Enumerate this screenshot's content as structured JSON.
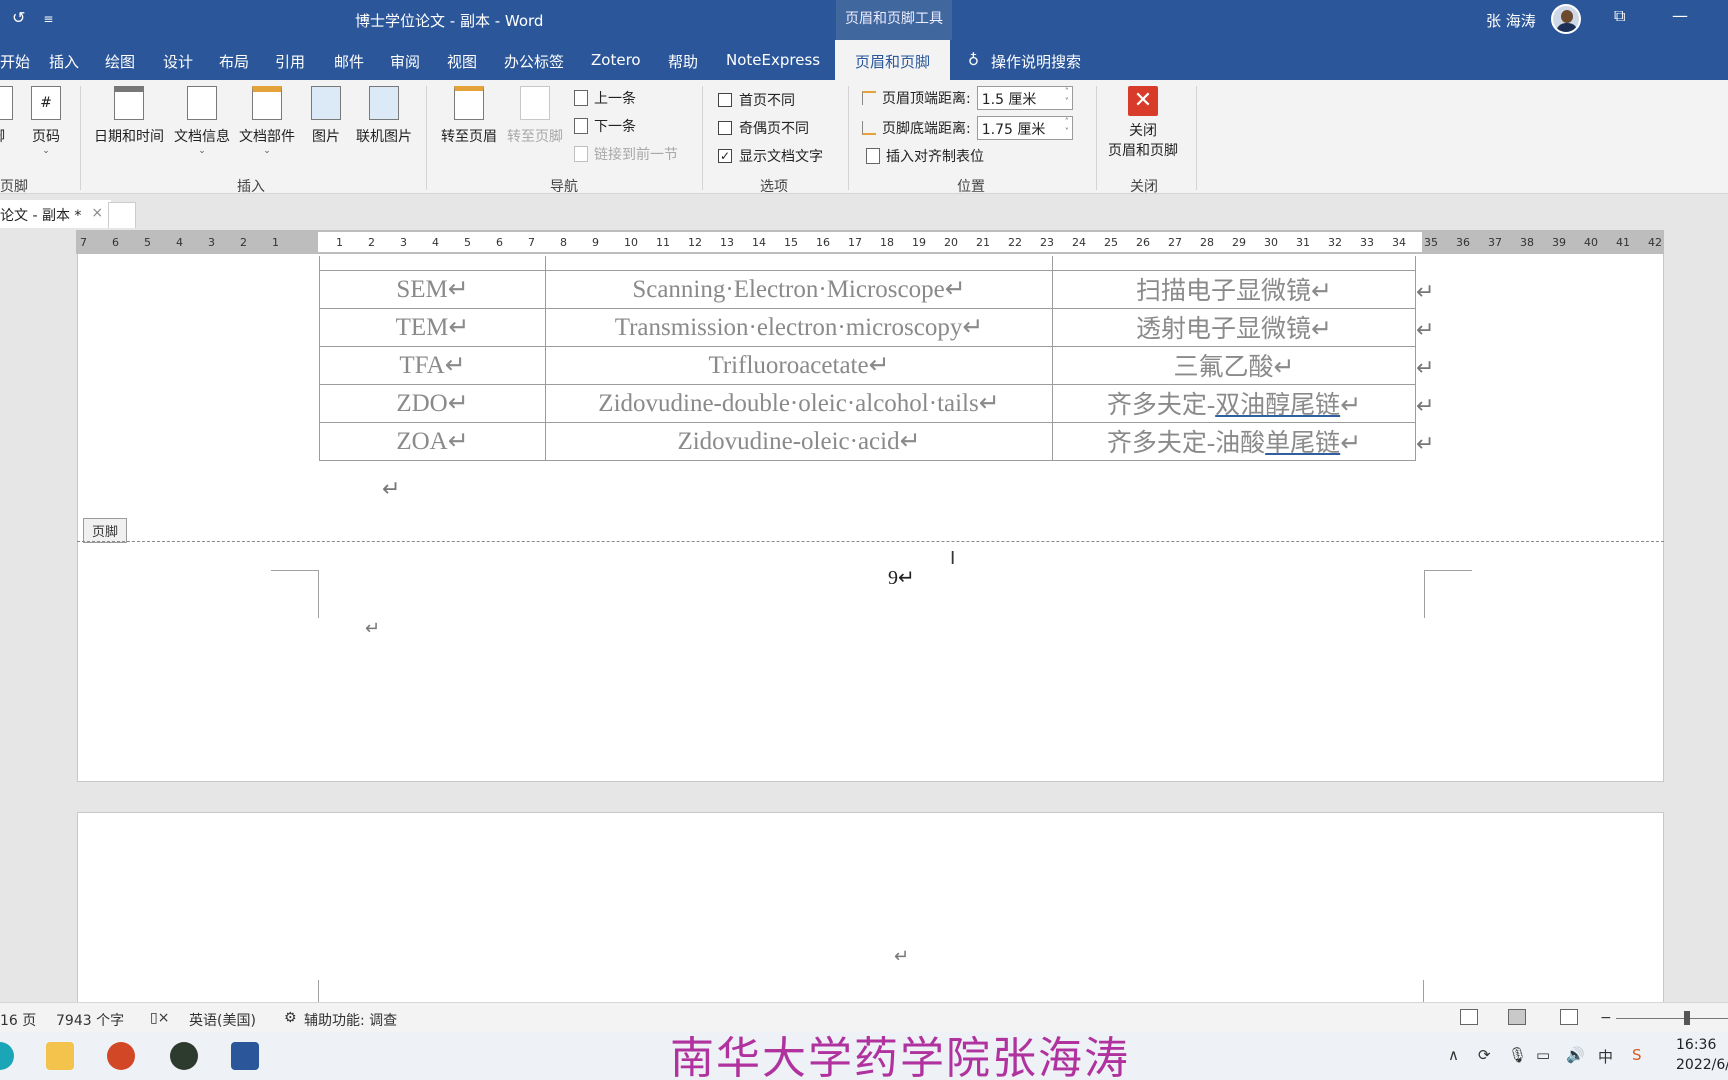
{
  "titlebar": {
    "doc_title": "博士学位论文 - 副本  -  Word",
    "context_tools": "页眉和页脚工具",
    "user_name": "张 海涛",
    "refresh_icon": "↺",
    "qat_icon": "≡",
    "restore_icon": "⧉",
    "minimize_icon": "—"
  },
  "tabs": [
    "开始",
    "插入",
    "绘图",
    "设计",
    "布局",
    "引用",
    "邮件",
    "审阅",
    "视图",
    "办公标签",
    "Zotero",
    "帮助",
    "NoteExpress",
    "页眉和页脚"
  ],
  "tell_me": "操作说明搜索",
  "ribbon": {
    "partial_btn": "脚",
    "page_number_btn": "页码",
    "insert_group": {
      "label": "插入",
      "buttons": [
        "日期和时间",
        "文档信息",
        "文档部件",
        "图片",
        "联机图片"
      ]
    },
    "footer_group_label": "页脚",
    "nav_group": {
      "label": "导航",
      "goto_header": "转至页眉",
      "goto_footer": "转至页脚",
      "previous": "上一条",
      "next": "下一条",
      "link_previous": "链接到前一节"
    },
    "options_group": {
      "label": "选项",
      "different_first": "首页不同",
      "different_odd_even": "奇偶页不同",
      "show_doc_text": "显示文档文字",
      "show_doc_text_checked": true
    },
    "position_group": {
      "label": "位置",
      "header_top_label": "页眉顶端距离:",
      "header_top_value": "1.5 厘米",
      "footer_bottom_label": "页脚底端距离:",
      "footer_bottom_value": "1.75 厘米",
      "insert_align_tab": "插入对齐制表位"
    },
    "close_group": {
      "label": "关闭",
      "close_line1": "关闭",
      "close_line2": "页眉和页脚"
    }
  },
  "doc_tab": {
    "label": "论文 - 副本 *",
    "close": "×"
  },
  "ruler_numbers": [
    "7",
    "6",
    "5",
    "4",
    "3",
    "2",
    "1",
    "",
    "1",
    "2",
    "3",
    "4",
    "5",
    "6",
    "7",
    "8",
    "9",
    "10",
    "11",
    "12",
    "13",
    "14",
    "15",
    "16",
    "17",
    "18",
    "19",
    "20",
    "21",
    "22",
    "23",
    "24",
    "25",
    "26",
    "27",
    "28",
    "29",
    "30",
    "31",
    "32",
    "33",
    "34",
    "35",
    "36",
    "37",
    "38",
    "39",
    "40",
    "41",
    "42"
  ],
  "table_rows": [
    {
      "abbr": "SEM↵",
      "english": "Scanning·Electron·Microscope↵",
      "chinese": "扫描电子显微镜↵"
    },
    {
      "abbr": "TEM↵",
      "english": "Transmission·electron·microscopy↵",
      "chinese": "透射电子显微镜↵"
    },
    {
      "abbr": "TFA↵",
      "english": "Trifluoroacetate↵",
      "chinese": "三氟乙酸↵"
    },
    {
      "abbr": "ZDO↵",
      "english": "Zidovudine-double·oleic·alcohol·tails↵",
      "chinese_plain": "齐多夫定-",
      "chinese_ul": "双油醇尾链",
      "chinese_end": "↵"
    },
    {
      "abbr": "ZOA↵",
      "english": "Zidovudine-oleic·acid↵",
      "chinese_plain": "齐多夫定-油酸",
      "chinese_ul": "单尾链",
      "chinese_end": "↵"
    }
  ],
  "row_end_mark": "↵",
  "paragraph_mark": "↵",
  "footer_tag": "页脚",
  "page_number": "9↵",
  "statusbar": {
    "pages": "16 页",
    "words": "7943 个字",
    "language": "英语(美国)",
    "accessibility": "辅助功能: 调查",
    "zoom_minus": "−"
  },
  "watermark": "南华大学药学院张海涛",
  "taskbar": {
    "tray_icons": "∧",
    "ime": "中",
    "time": "16:36",
    "date": "2022/6/"
  }
}
